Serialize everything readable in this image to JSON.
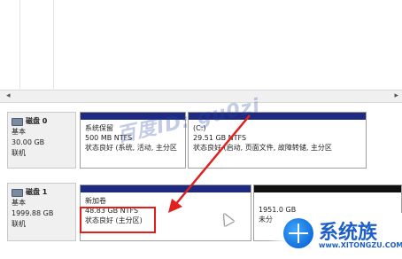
{
  "disks": [
    {
      "name": "磁盘 0",
      "type": "基本",
      "size": "30.00 GB",
      "status": "联机"
    },
    {
      "name": "磁盘 1",
      "type": "基本",
      "size": "1999.88 GB",
      "status": "联机"
    }
  ],
  "partitions": {
    "system_reserved": {
      "title": "系统保留",
      "size": "500 MB NTFS",
      "status": "状态良好 (系统, 活动, 主分区"
    },
    "c_drive": {
      "title": "(C:)",
      "size": "29.51 GB NTFS",
      "status": "状态良好 (启动, 页面文件, 故障转储, 主分区"
    },
    "new_volume": {
      "title": "新加卷",
      "size": "48.83 GB NTFS",
      "status": "状态良好 (主分区)"
    },
    "unallocated": {
      "size": "1951.0 GB",
      "status": "未分"
    }
  },
  "watermark_text": "百度ID: gu0zi",
  "logo": {
    "brand": "系统族",
    "url": "www.XITONGZU.COM"
  },
  "colors": {
    "primary_stripe": "#1e2a82",
    "unallocated_stripe": "#111111",
    "highlight": "#e0201d"
  }
}
